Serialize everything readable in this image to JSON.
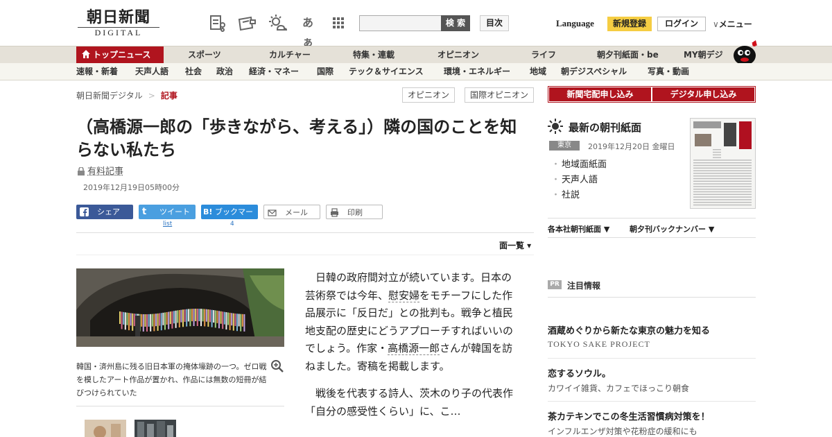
{
  "header": {
    "logo_main": "朝日新聞",
    "logo_sub": "DIGITAL",
    "font_icon_text": "あぁ",
    "search_button": "検 索",
    "index_button": "目次",
    "language": "Language",
    "signup": "新規登録",
    "login": "ログイン",
    "menu": "メニュー",
    "menu_chevron": "∨"
  },
  "gnav": {
    "items": [
      "トップニュース",
      "スポーツ",
      "カルチャー",
      "特集・連載",
      "オピニオン",
      "ライフ",
      "朝夕刊紙面・be",
      "MY朝デジ"
    ]
  },
  "snav": {
    "items": [
      "速報・新着",
      "天声人語",
      "社会",
      "政治",
      "経済・マネー",
      "国際",
      "テック＆サイエンス",
      "環境・エネルギー",
      "地域",
      "朝デジスペシャル",
      "写真・動画"
    ]
  },
  "article": {
    "breadcrumb": [
      "朝日新聞デジタル",
      "記事"
    ],
    "breadcrumb_sep": ">",
    "tags": [
      "オピニオン",
      "国際オピニオン"
    ],
    "title": "（高橋源一郎の「歩きながら、考える」）隣の国のことを知らない私たち",
    "paid_label": "有料記事",
    "date": "2019年12月19日05時00分",
    "share": {
      "facebook": "シェア",
      "twitter": "ツイート",
      "twitter_icon": "t",
      "hatena_icon": "B!",
      "hatena": "ブックマーク",
      "mail": "メール",
      "print": "印刷",
      "twitter_count": "list",
      "hatena_count": "4"
    },
    "page_list": "面一覧 ▾",
    "caption": "韓国・済州島に残る旧日本軍の掩体壕跡の一つ。ゼロ戦を模したアート作品が置かれ、作品には無数の短冊が結びつけられていた",
    "p1_a": "日韓の政府間対立が続いています。日本の芸術祭では今年、",
    "p1_link1": "慰安婦",
    "p1_b": "をモチーフにした作品展示に「反日だ」との批判も。戦争と植民地支配の歴史にどうアプローチすればいいのでしょう。作家・",
    "p1_link2": "高橋源一郎",
    "p1_c": "さんが韓国を訪ねました。寄稿を掲載します。",
    "p2": "戦後を代表する詩人、茨木のり子の代表作「自分の感受性くらい」に、こ…"
  },
  "sidebar": {
    "order_home": "新聞宅配申し込み",
    "order_digital": "デジタル申し込み",
    "paper_title": "最新の朝刊紙面",
    "region": "東京",
    "paper_date": "2019年12月20日 金曜日",
    "paper_links": [
      "地域面紙面",
      "天声人語",
      "社説"
    ],
    "dropdown1": "各本社朝刊紙面 ▼",
    "dropdown2": "朝夕刊バックナンバー ▼",
    "pr_badge": "PR",
    "pr_heading": "注目情報",
    "ads": [
      {
        "title": "酒蔵めぐりから新たな東京の魅力を知る",
        "sub": "TOKYO SAKE PROJECT"
      },
      {
        "title": "恋するソウル。",
        "sub": "カワイイ雑貨、カフェでほっこり朝食"
      },
      {
        "title": "茶カテキンでこの冬生活習慣病対策を！",
        "sub": "インフルエンザ対策や花粉症の緩和にも"
      }
    ]
  },
  "colors": {
    "brand_red": "#b0141e",
    "signup_yellow": "#f5cd43",
    "nav_bg": "#e5e1d8"
  }
}
